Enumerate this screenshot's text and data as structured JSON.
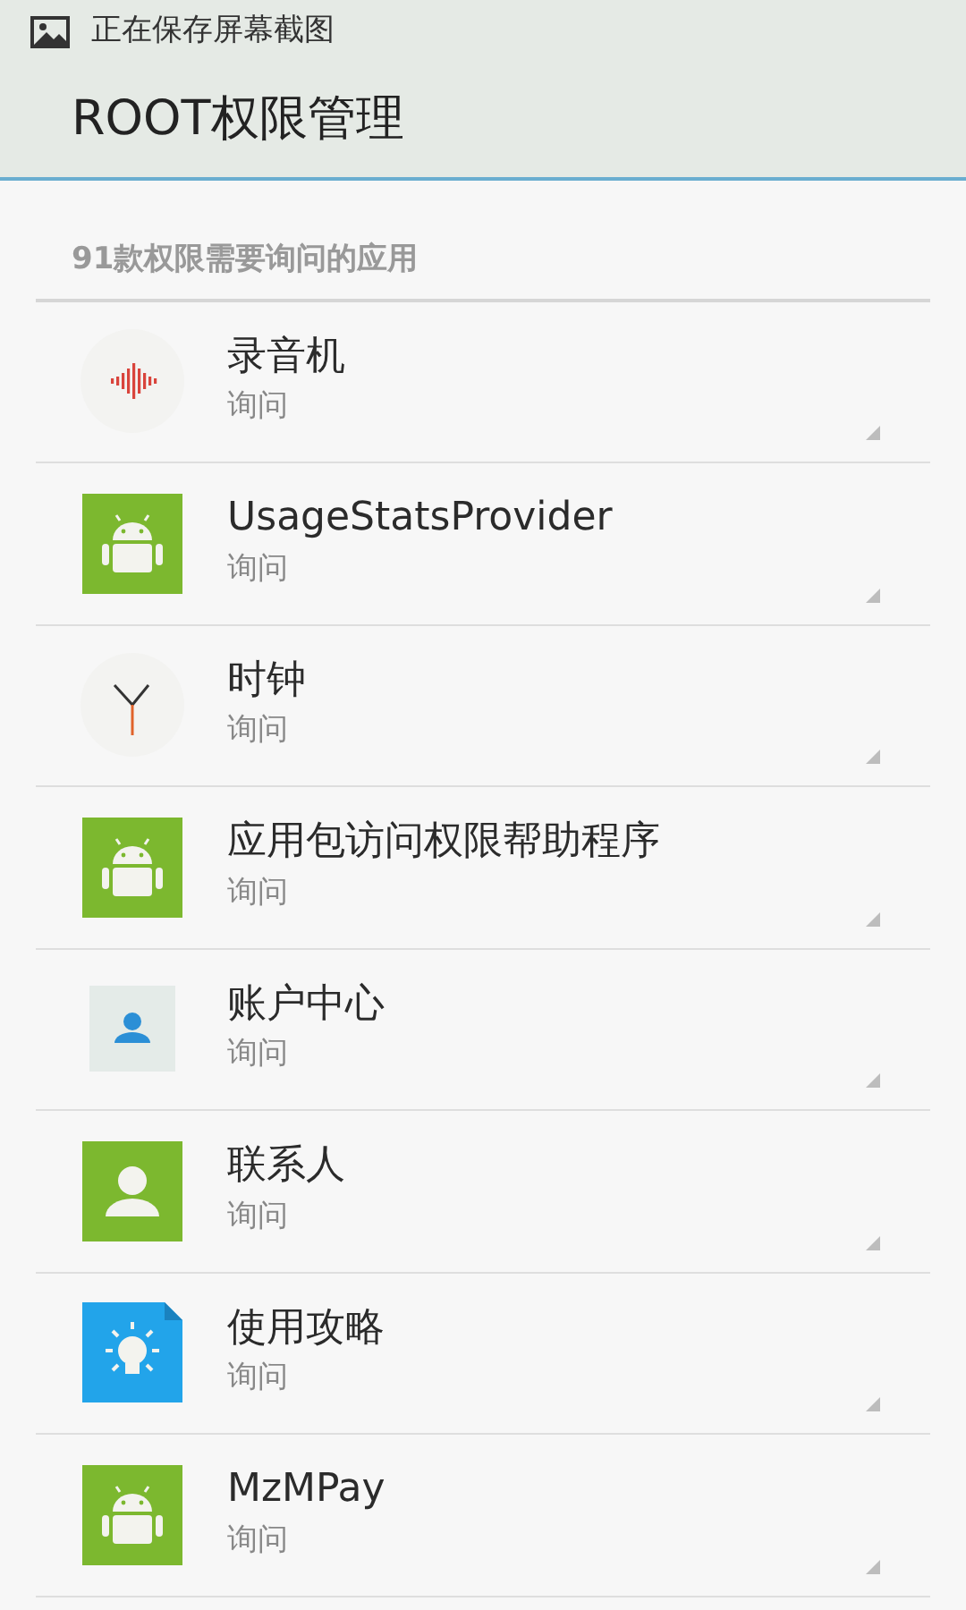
{
  "status_bar": {
    "notification": "正在保存屏幕截图"
  },
  "header": {
    "title": "ROOT权限管理"
  },
  "section": {
    "title": "91款权限需要询问的应用"
  },
  "apps": [
    {
      "name": "录音机",
      "permission": "询问",
      "kind": "recorder"
    },
    {
      "name": "UsageStatsProvider",
      "permission": "询问",
      "kind": "android"
    },
    {
      "name": "时钟",
      "permission": "询问",
      "kind": "clock"
    },
    {
      "name": "应用包访问权限帮助程序",
      "permission": "询问",
      "kind": "android"
    },
    {
      "name": "账户中心",
      "permission": "询问",
      "kind": "account"
    },
    {
      "name": "联系人",
      "permission": "询问",
      "kind": "contacts"
    },
    {
      "name": "使用攻略",
      "permission": "询问",
      "kind": "guide"
    },
    {
      "name": "MzMPay",
      "permission": "询问",
      "kind": "android"
    }
  ]
}
